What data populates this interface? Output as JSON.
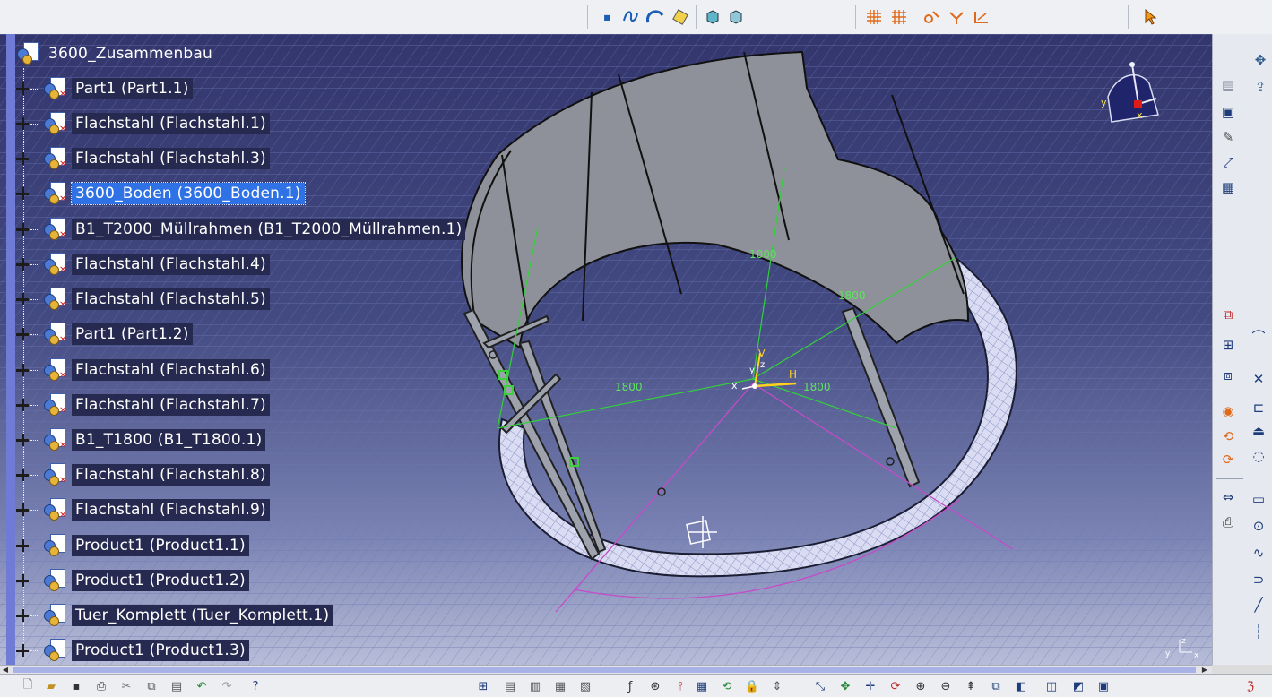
{
  "tree": {
    "root": {
      "label": "3600_Zusammenbau"
    },
    "nodes": [
      {
        "label": "Part1 (Part1.1)"
      },
      {
        "label": "Flachstahl (Flachstahl.1)"
      },
      {
        "label": "Flachstahl (Flachstahl.3)"
      },
      {
        "label": "3600_Boden (3600_Boden.1)",
        "selected": true
      },
      {
        "label": "B1_T2000_Müllrahmen (B1_T2000_Müllrahmen.1)"
      },
      {
        "label": "Flachstahl (Flachstahl.4)"
      },
      {
        "label": "Flachstahl (Flachstahl.5)"
      },
      {
        "label": "Part1 (Part1.2)"
      },
      {
        "label": "Flachstahl (Flachstahl.6)"
      },
      {
        "label": "Flachstahl (Flachstahl.7)"
      },
      {
        "label": "B1_T1800 (B1_T1800.1)"
      },
      {
        "label": "Flachstahl (Flachstahl.8)"
      },
      {
        "label": "Flachstahl (Flachstahl.9)"
      },
      {
        "label": "Product1 (Product1.1)"
      },
      {
        "label": "Product1 (Product1.2)"
      },
      {
        "label": "Tuer_Komplett (Tuer_Komplett.1)"
      },
      {
        "label": "Product1 (Product1.3)"
      }
    ]
  },
  "viewport": {
    "dimensions": [
      "1800",
      "1800",
      "1800",
      "1800"
    ],
    "axis_labels": {
      "h": "H",
      "v": "V",
      "x": "x",
      "y": "y",
      "z": "z"
    },
    "compass_axes": {
      "x": "x",
      "y": "y"
    },
    "corner_axes": {
      "x": "x",
      "y": "y",
      "z": "z"
    }
  },
  "colors": {
    "selection": "#2f72e6",
    "dimension": "#5fe35f",
    "constraint": "#c64ac8",
    "axis": "#ffd21f"
  },
  "icons": {
    "top": [
      "point-icon",
      "spline-icon",
      "arc-icon",
      "sketch-tools-icon",
      "view-cube-icon",
      "view-cube-2-icon",
      "grid-icon",
      "snap-grid-icon",
      "constraint-icon",
      "auto-constraint-icon",
      "dimension-icon",
      "select-arrow-icon"
    ],
    "right": [
      "compass-arrow-icon",
      "insert-icon",
      "assembly-icon",
      "flexible-icon",
      "pen-icon",
      "manipulate-icon",
      "explode-icon",
      "constraint-tools-icon",
      "fix-icon",
      "contact-icon",
      "offset-icon",
      "angle-icon",
      "measure-icon",
      "analysis-icon"
    ],
    "bottom": [
      "new-icon",
      "open-icon",
      "save-icon",
      "print-icon",
      "cut-icon",
      "copy-icon",
      "paste-icon",
      "undo-icon",
      "redo-icon",
      "help-icon",
      "tree-icon",
      "fit-all-icon",
      "pan-icon",
      "rotate-icon",
      "zoom-in-icon",
      "zoom-out-icon",
      "normal-view-icon",
      "iso-view-icon",
      "shading-icon",
      "hide-show-icon",
      "swap-icon",
      "catia-logo-icon"
    ]
  }
}
